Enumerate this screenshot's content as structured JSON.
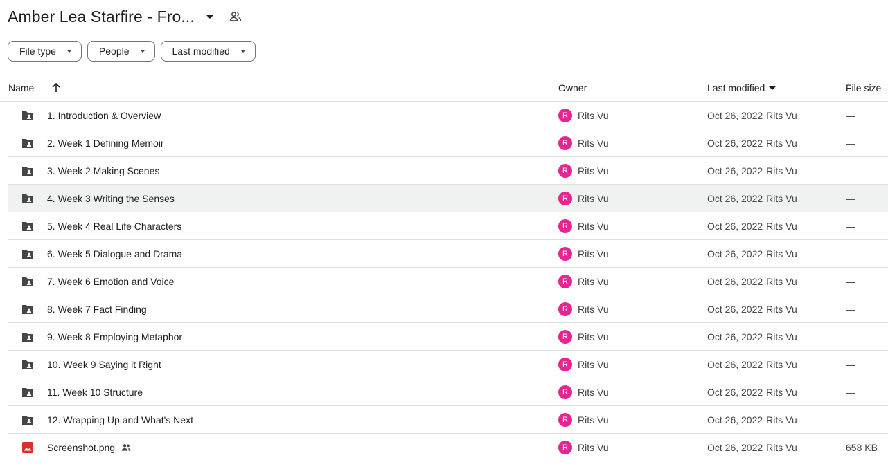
{
  "header": {
    "title": "Amber Lea Starfire - Fro...",
    "title_menu_icon": "arrow-drop-down-icon",
    "shared_icon": "people-outline-icon"
  },
  "filters": [
    {
      "label": "File type",
      "icon": "arrow-drop-down-icon"
    },
    {
      "label": "People",
      "icon": "arrow-drop-down-icon"
    },
    {
      "label": "Last modified",
      "icon": "arrow-drop-down-icon"
    }
  ],
  "table": {
    "headers": {
      "name": "Name",
      "owner": "Owner",
      "last_modified": "Last modified",
      "file_size": "File size"
    },
    "sort_icon": "arrow-upward-icon",
    "rows": [
      {
        "name": "1. Introduction & Overview",
        "type": "shared-folder",
        "owner_initial": "R",
        "owner": "Rits Vu",
        "modified_date": "Oct 26, 2022",
        "modified_by": "Rits Vu",
        "size": "—"
      },
      {
        "name": "2. Week 1 Defining Memoir",
        "type": "shared-folder",
        "owner_initial": "R",
        "owner": "Rits Vu",
        "modified_date": "Oct 26, 2022",
        "modified_by": "Rits Vu",
        "size": "—"
      },
      {
        "name": "3. Week 2 Making Scenes",
        "type": "shared-folder",
        "owner_initial": "R",
        "owner": "Rits Vu",
        "modified_date": "Oct 26, 2022",
        "modified_by": "Rits Vu",
        "size": "—"
      },
      {
        "name": "4. Week 3 Writing the Senses",
        "type": "shared-folder",
        "owner_initial": "R",
        "owner": "Rits Vu",
        "modified_date": "Oct 26, 2022",
        "modified_by": "Rits Vu",
        "size": "—",
        "highlighted": true
      },
      {
        "name": "5. Week 4 Real Life Characters",
        "type": "shared-folder",
        "owner_initial": "R",
        "owner": "Rits Vu",
        "modified_date": "Oct 26, 2022",
        "modified_by": "Rits Vu",
        "size": "—"
      },
      {
        "name": "6. Week 5 Dialogue and Drama",
        "type": "shared-folder",
        "owner_initial": "R",
        "owner": "Rits Vu",
        "modified_date": "Oct 26, 2022",
        "modified_by": "Rits Vu",
        "size": "—"
      },
      {
        "name": "7. Week 6 Emotion and Voice",
        "type": "shared-folder",
        "owner_initial": "R",
        "owner": "Rits Vu",
        "modified_date": "Oct 26, 2022",
        "modified_by": "Rits Vu",
        "size": "—"
      },
      {
        "name": "8. Week 7 Fact Finding",
        "type": "shared-folder",
        "owner_initial": "R",
        "owner": "Rits Vu",
        "modified_date": "Oct 26, 2022",
        "modified_by": "Rits Vu",
        "size": "—"
      },
      {
        "name": "9. Week 8 Employing Metaphor",
        "type": "shared-folder",
        "owner_initial": "R",
        "owner": "Rits Vu",
        "modified_date": "Oct 26, 2022",
        "modified_by": "Rits Vu",
        "size": "—"
      },
      {
        "name": "10. Week 9 Saying it Right",
        "type": "shared-folder",
        "owner_initial": "R",
        "owner": "Rits Vu",
        "modified_date": "Oct 26, 2022",
        "modified_by": "Rits Vu",
        "size": "—"
      },
      {
        "name": "11. Week 10 Structure",
        "type": "shared-folder",
        "owner_initial": "R",
        "owner": "Rits Vu",
        "modified_date": "Oct 26, 2022",
        "modified_by": "Rits Vu",
        "size": "—"
      },
      {
        "name": "12. Wrapping Up and What's Next",
        "type": "shared-folder",
        "owner_initial": "R",
        "owner": "Rits Vu",
        "modified_date": "Oct 26, 2022",
        "modified_by": "Rits Vu",
        "size": "—"
      },
      {
        "name": "Screenshot.png",
        "type": "image",
        "shared": true,
        "owner_initial": "R",
        "owner": "Rits Vu",
        "modified_date": "Oct 26, 2022",
        "modified_by": "Rits Vu",
        "size": "658 KB"
      }
    ]
  },
  "colors": {
    "folder_icon": "#444746",
    "image_icon": "#d93025",
    "avatar_bg": "#e52592",
    "row_highlight": "#f0f2f1",
    "divider": "#e0e0e0"
  }
}
